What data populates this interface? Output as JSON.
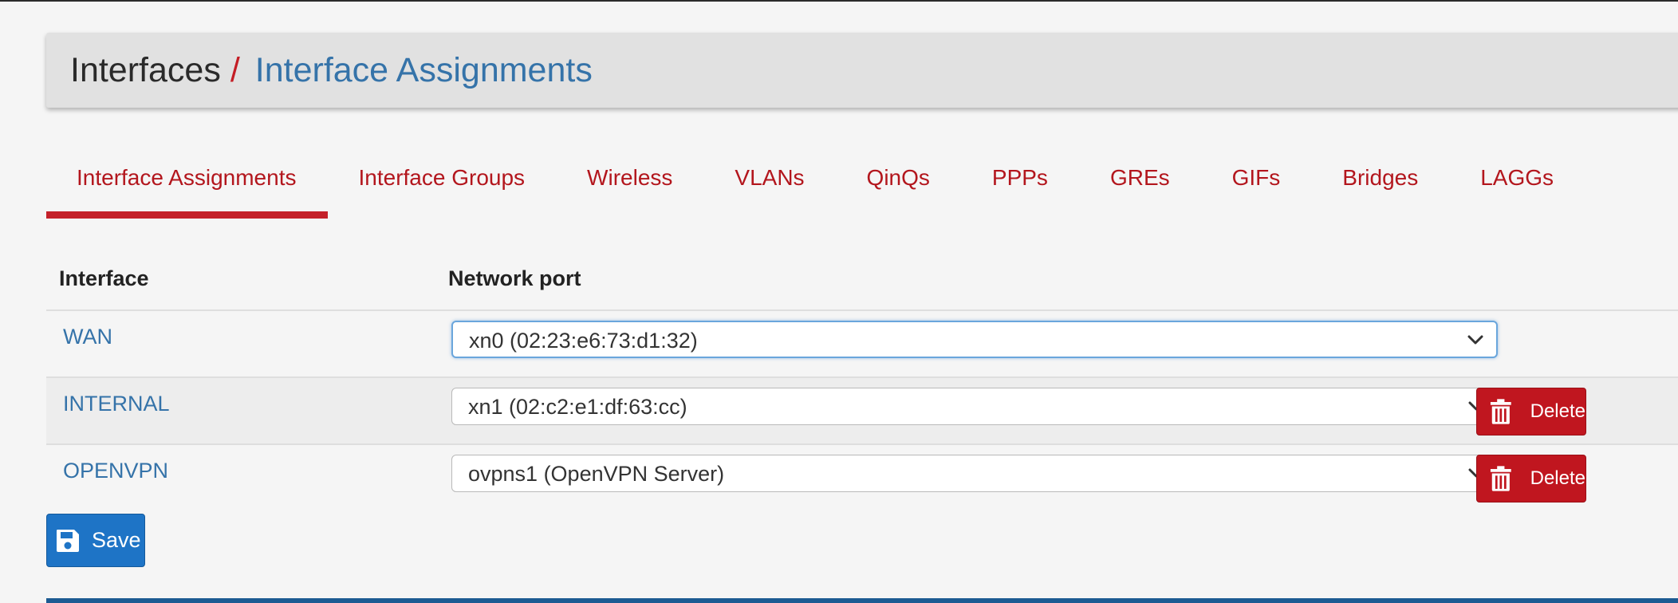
{
  "breadcrumb": {
    "root": "Interfaces",
    "separator": "/",
    "current": "Interface Assignments"
  },
  "tabs": [
    {
      "label": "Interface Assignments",
      "active": true
    },
    {
      "label": "Interface Groups",
      "active": false
    },
    {
      "label": "Wireless",
      "active": false
    },
    {
      "label": "VLANs",
      "active": false
    },
    {
      "label": "QinQs",
      "active": false
    },
    {
      "label": "PPPs",
      "active": false
    },
    {
      "label": "GREs",
      "active": false
    },
    {
      "label": "GIFs",
      "active": false
    },
    {
      "label": "Bridges",
      "active": false
    },
    {
      "label": "LAGGs",
      "active": false
    }
  ],
  "table": {
    "headers": {
      "interface": "Interface",
      "network_port": "Network port"
    },
    "rows": [
      {
        "interface": "WAN",
        "port": "xn0 (02:23:e6:73:d1:32)",
        "focused": true
      },
      {
        "interface": "INTERNAL",
        "port": "xn1 (02:c2:e1:df:63:cc)",
        "delete_label": "Delete"
      },
      {
        "interface": "OPENVPN",
        "port": "ovpns1 (OpenVPN Server)",
        "delete_label": "Delete"
      }
    ]
  },
  "actions": {
    "save_label": "Save"
  },
  "icons": {
    "select_arrow": "chevron-down-icon",
    "delete": "trash-icon",
    "save": "floppy-disk-icon"
  },
  "colors": {
    "tab_text": "#b3161d",
    "tab_active_underline": "#c4212a",
    "link": "#3573a9",
    "delete_button": "#c0161f",
    "save_button": "#1e74c6",
    "header_bg": "#e1e1e1",
    "page_bg": "#f5f5f5"
  }
}
